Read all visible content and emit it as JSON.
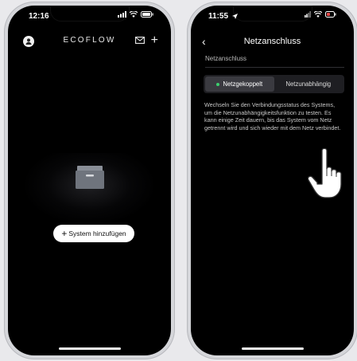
{
  "left_phone": {
    "time": "12:16",
    "brand": "ECOFLOW",
    "add_button_label": "System hinzufügen",
    "add_button_plus": "+",
    "header_plus": "+"
  },
  "right_phone": {
    "time": "11:55",
    "back_glyph": "‹",
    "title": "Netzanschluss",
    "section_label": "Netzanschluss",
    "segments": [
      {
        "label": "Netzgekoppelt",
        "active": true
      },
      {
        "label": "Netzunabhängig",
        "active": false
      }
    ],
    "description": "Wechseln Sie den Verbindungsstatus des Systems, um die Netzunabhängigkeitsfunktion zu testen. Es kann einige Zeit dauern, bis das System vom Netz getrennt wird und sich wieder mit dem Netz verbindet."
  },
  "colors": {
    "accent_green": "#3ccf6e",
    "background": "#000000",
    "frame": "#d5d6da"
  },
  "icons": [
    "avatar-icon",
    "mail-icon",
    "plus-icon",
    "box-icon",
    "back-icon",
    "signal-icon",
    "wifi-icon",
    "battery-icon",
    "location-arrow-icon",
    "pointing-hand-icon"
  ]
}
